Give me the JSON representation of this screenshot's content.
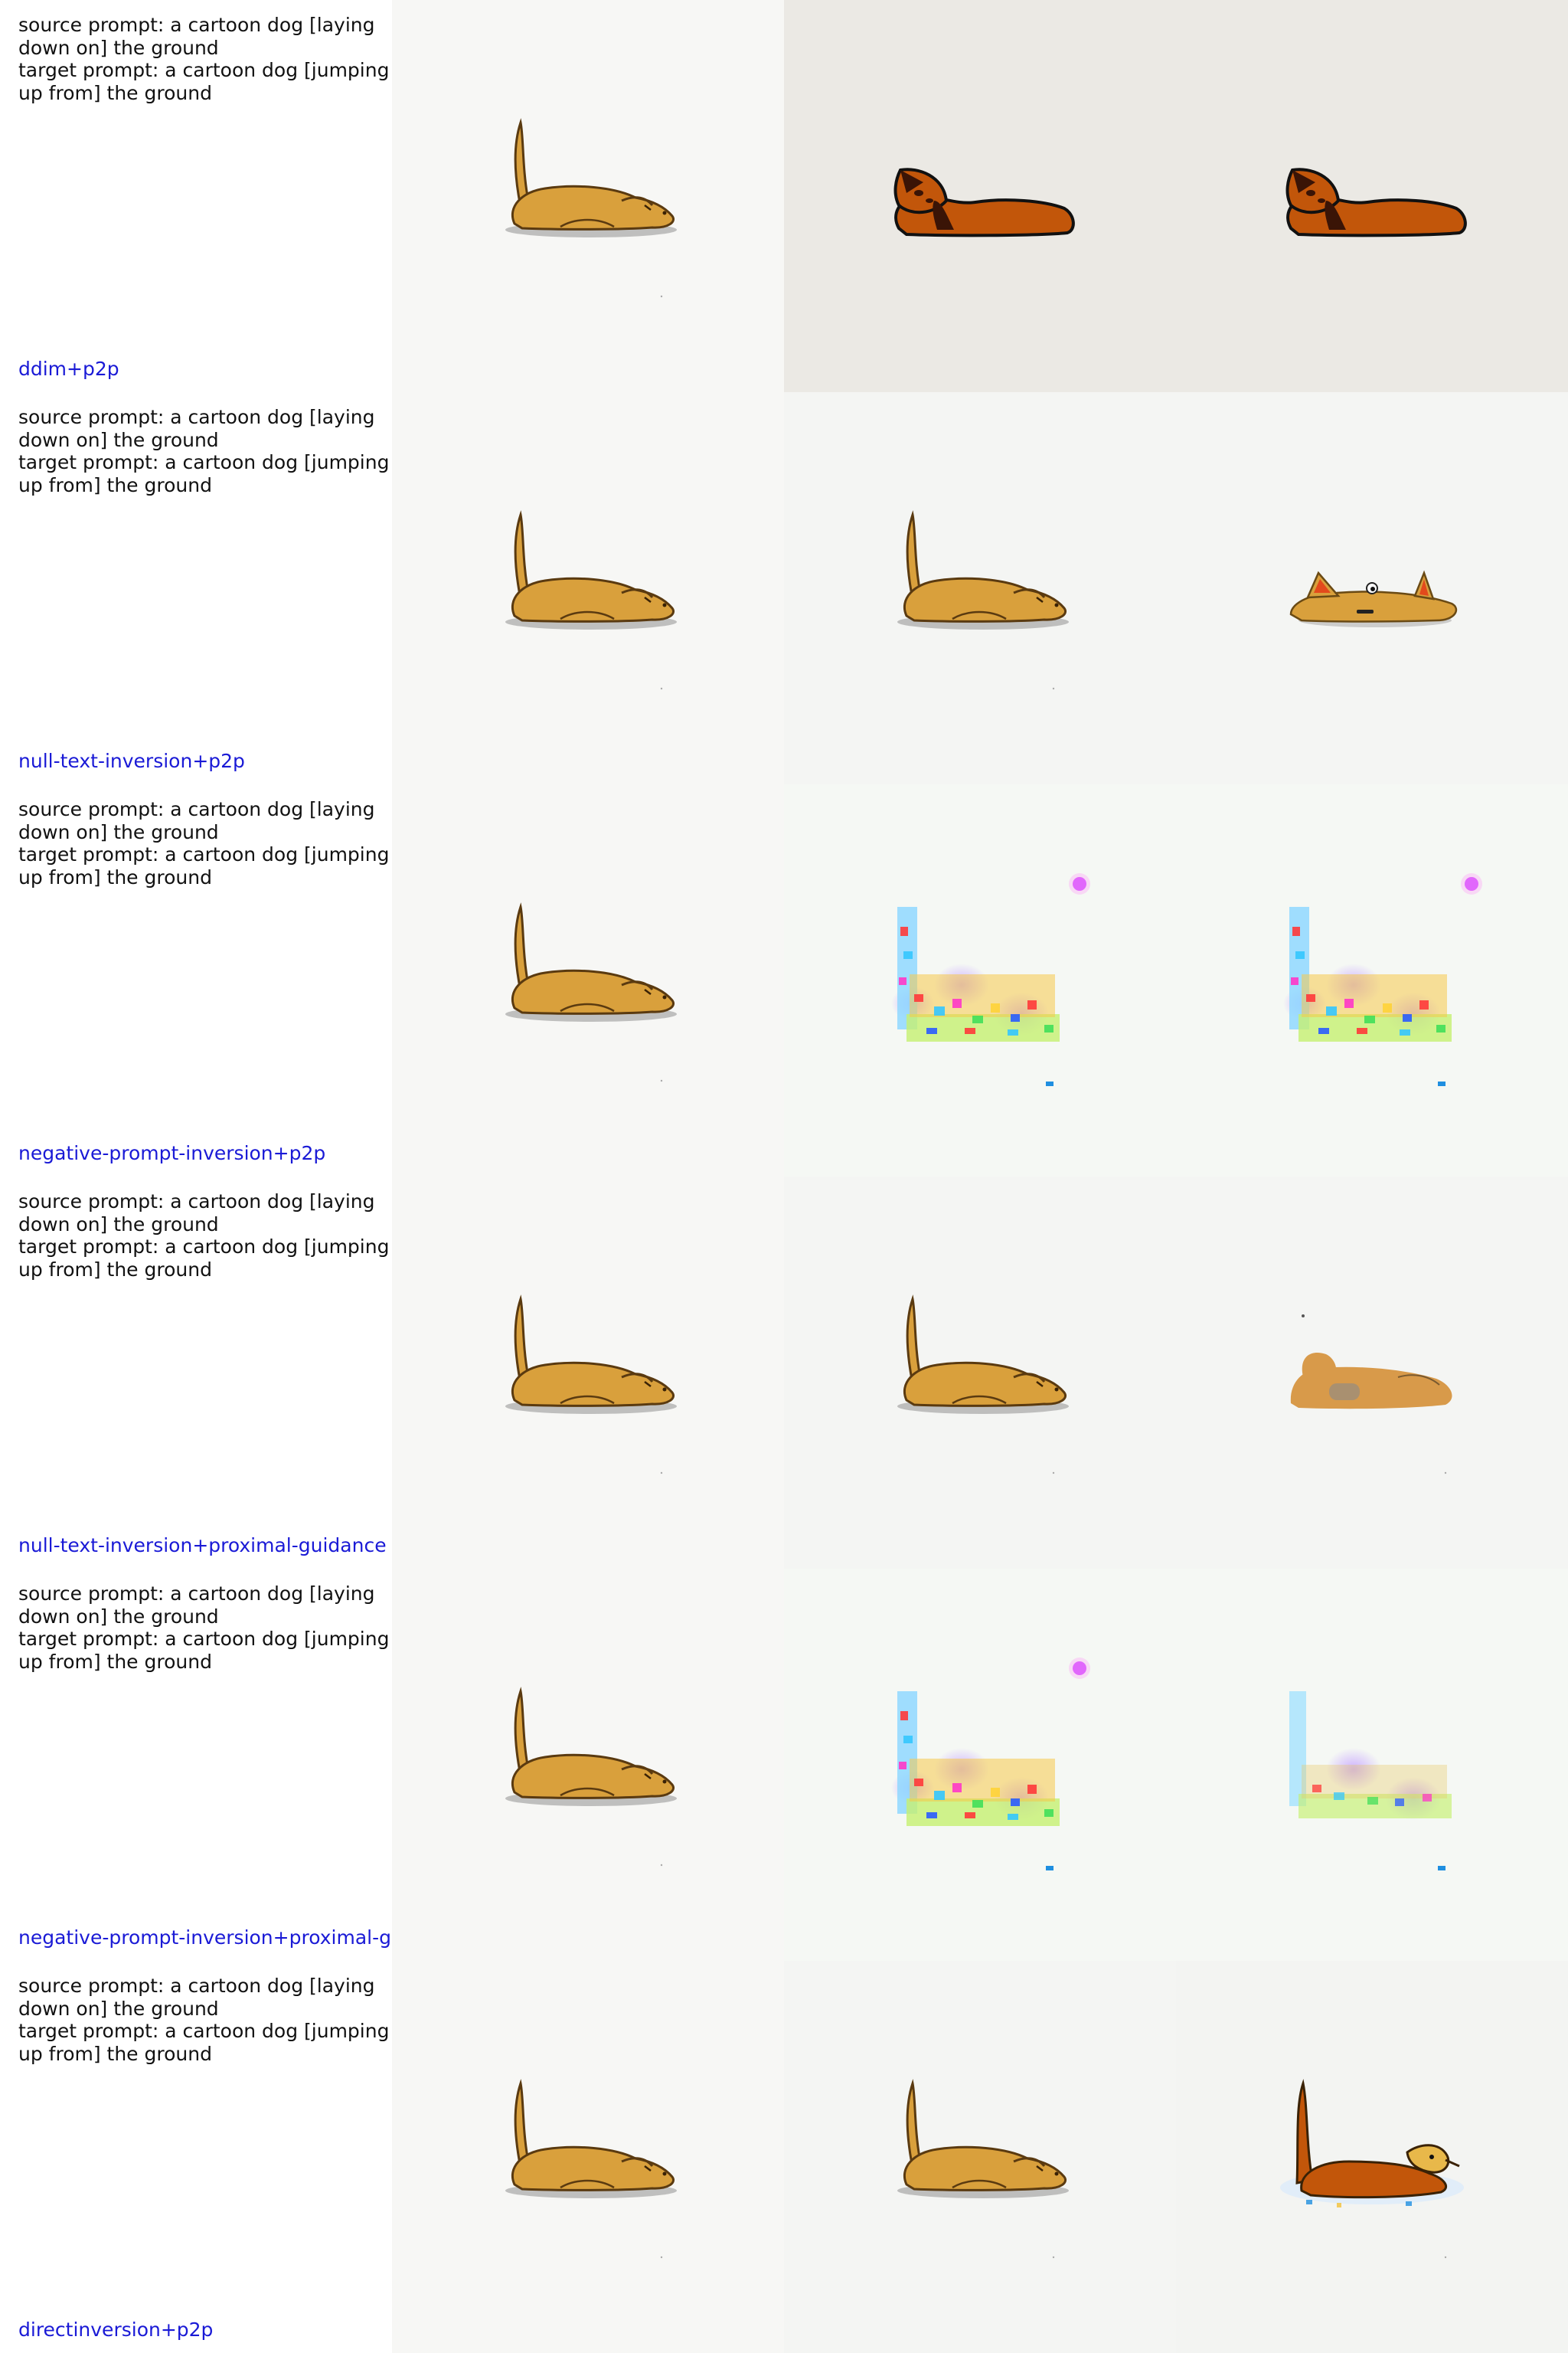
{
  "rows": [
    {
      "source_prompt": "source prompt: a cartoon dog [laying down on] the ground",
      "target_prompt": "target prompt: a cartoon dog [jumping up from] the ground",
      "method": "ddim+p2p",
      "images": [
        "source-dog-lying",
        "brown-dog-lying-dark-ears",
        "brown-dog-lying-dark-ears"
      ]
    },
    {
      "source_prompt": "source prompt: a cartoon dog [laying down on] the ground",
      "target_prompt": "target prompt: a cartoon dog [jumping up from] the ground",
      "method": "null-text-inversion+p2p",
      "images": [
        "source-dog-lying",
        "reconstructed-dog-lying",
        "flat-dog-with-pointed-ears"
      ]
    },
    {
      "source_prompt": "source prompt: a cartoon dog [laying down on] the ground",
      "target_prompt": "target prompt: a cartoon dog [jumping up from] the ground",
      "method": "negative-prompt-inversion+p2p",
      "images": [
        "source-dog-lying",
        "colorful-noise-artifact",
        "colorful-noise-artifact"
      ]
    },
    {
      "source_prompt": "source prompt: a cartoon dog [laying down on] the ground",
      "target_prompt": "target prompt: a cartoon dog [jumping up from] the ground",
      "method": "null-text-inversion+proximal-guidance",
      "images": [
        "source-dog-lying",
        "reconstructed-dog-lying",
        "blurred-dog-lying"
      ]
    },
    {
      "source_prompt": "source prompt: a cartoon dog [laying down on] the ground",
      "target_prompt": "target prompt: a cartoon dog [jumping up from] the ground",
      "method": "negative-prompt-inversion+proximal-g",
      "images": [
        "source-dog-lying",
        "colorful-noise-artifact",
        "colorful-noise-artifact-faded"
      ]
    },
    {
      "source_prompt": "source prompt: a cartoon dog [laying down on] the ground",
      "target_prompt": "target prompt: a cartoon dog [jumping up from] the ground",
      "method": "directinversion+p2p",
      "images": [
        "source-dog-lying",
        "reconstructed-dog-lying",
        "dog-lifting-up"
      ]
    }
  ],
  "colors": {
    "method_label": "#1a1ad6",
    "prompt_text": "#111111",
    "dog_fill": "#d9a03c",
    "brown_dog_fill": "#c2560a",
    "dark_ear": "#3a1406"
  }
}
